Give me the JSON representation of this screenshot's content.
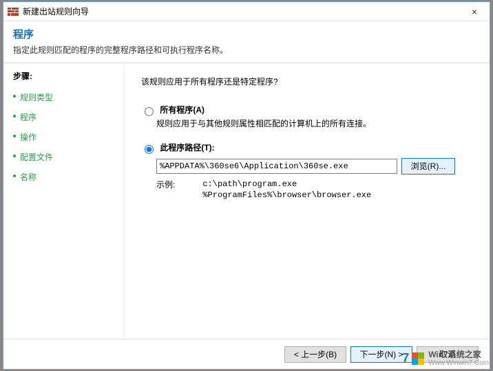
{
  "window": {
    "title": "新建出站规则向导"
  },
  "header": {
    "title": "程序",
    "subtitle": "指定此规则匹配的程序的完整程序路径和可执行程序名称。"
  },
  "sidebar": {
    "steps_label": "步骤:",
    "items": [
      "规则类型",
      "程序",
      "操作",
      "配置文件",
      "名称"
    ]
  },
  "content": {
    "question": "该规则应用于所有程序还是特定程序?",
    "option_all": {
      "label": "所有程序(A)",
      "desc": "规则应用于与其他规则属性相匹配的计算机上的所有连接。"
    },
    "option_path": {
      "label": "此程序路径(T):",
      "value": "%APPDATA%\\360se6\\Application\\360se.exe",
      "browse": "浏览(R)...",
      "example_label": "示例:",
      "example_line1": "c:\\path\\program.exe",
      "example_line2": "%ProgramFiles%\\browser\\browser.exe"
    }
  },
  "footer": {
    "back": "< 上一步(B)",
    "next": "下一步(N) >",
    "cancel": "取消"
  },
  "watermark": {
    "seven": "7",
    "cn": "Win7系统之家",
    "en": "Www.Winwin7.Com"
  }
}
